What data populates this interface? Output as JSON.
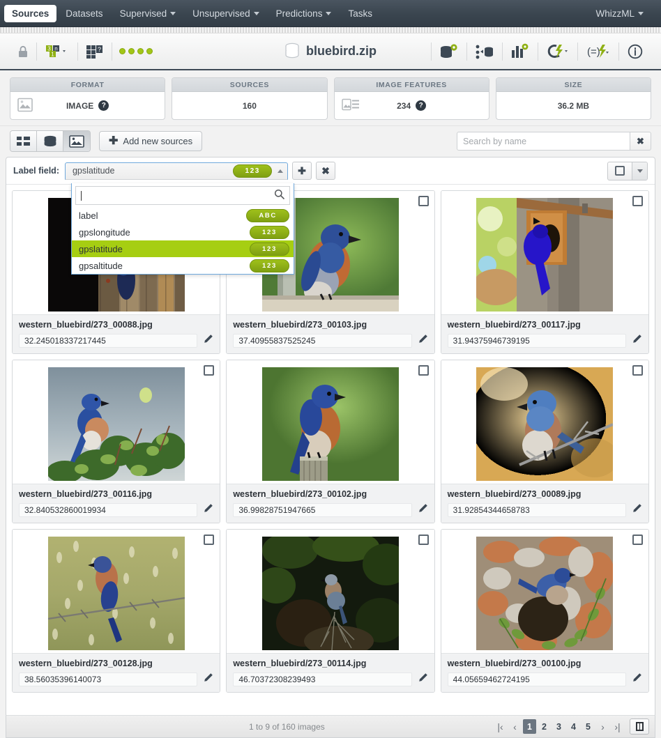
{
  "topnav": {
    "items": [
      {
        "label": "Sources",
        "active": true,
        "caret": false
      },
      {
        "label": "Datasets",
        "active": false,
        "caret": false
      },
      {
        "label": "Supervised",
        "active": false,
        "caret": true
      },
      {
        "label": "Unsupervised",
        "active": false,
        "caret": true
      },
      {
        "label": "Predictions",
        "active": false,
        "caret": true
      },
      {
        "label": "Tasks",
        "active": false,
        "caret": false
      }
    ],
    "right": {
      "label": "WhizzML",
      "caret": true
    }
  },
  "resource": {
    "title": "bluebird.zip",
    "left_icons": [
      "lock-icon",
      "field-types-icon",
      "dataset-transform-icon"
    ],
    "status_dots": 4,
    "right_icons": [
      "create-dataset-icon",
      "batch-source-icon",
      "statistics-icon",
      "flash-cluster-icon",
      "script-flash-icon",
      "info-icon"
    ]
  },
  "summary": [
    {
      "header": "FORMAT",
      "value": "IMAGE",
      "icon": "image-icon",
      "help": "?"
    },
    {
      "header": "SOURCES",
      "value": "160",
      "icon": null,
      "help": null
    },
    {
      "header": "IMAGE FEATURES",
      "value": "234",
      "icon": "image-list-icon",
      "help": "?"
    },
    {
      "header": "SIZE",
      "value": "36.2 MB",
      "icon": null,
      "help": null
    }
  ],
  "actionbar": {
    "views": [
      {
        "name": "list-view",
        "icon": "list-icon",
        "active": false
      },
      {
        "name": "composite-view",
        "icon": "stack-icon",
        "active": false
      },
      {
        "name": "image-view",
        "icon": "image-icon",
        "active": true
      }
    ],
    "add_sources_label": "Add new sources",
    "search_placeholder": "Search by name",
    "clear_label": "✖"
  },
  "label_field": {
    "caption": "Label field:",
    "selected": "gpslatitude",
    "selected_type": "123",
    "add_label": "✚",
    "remove_label": "✖",
    "search_value": "",
    "options": [
      {
        "name": "label",
        "type": "ABC",
        "selected": false
      },
      {
        "name": "gpslongitude",
        "type": "123",
        "selected": false
      },
      {
        "name": "gpslatitude",
        "type": "123",
        "selected": true
      },
      {
        "name": "gpsaltitude",
        "type": "123",
        "selected": false
      }
    ]
  },
  "images": [
    {
      "filename": "western_bluebird/273_00088.jpg",
      "value": "32.245018337217445",
      "thumb": "dark-wood-fence"
    },
    {
      "filename": "western_bluebird/273_00103.jpg",
      "value": "37.40955837525245",
      "thumb": "bluebird-on-post-green"
    },
    {
      "filename": "western_bluebird/273_00117.jpg",
      "value": "31.94375946739195",
      "thumb": "bluebird-at-nestbox"
    },
    {
      "filename": "western_bluebird/273_00116.jpg",
      "value": "32.840532860019934",
      "thumb": "bluebird-on-shrub-sky"
    },
    {
      "filename": "western_bluebird/273_00102.jpg",
      "value": "36.99828751947665",
      "thumb": "bluebird-on-stump-green"
    },
    {
      "filename": "western_bluebird/273_00089.jpg",
      "value": "31.92854344658783",
      "thumb": "bluebird-on-branch-gold"
    },
    {
      "filename": "western_bluebird/273_00128.jpg",
      "value": "38.56035396140073",
      "thumb": "bluebird-on-barbed-wire"
    },
    {
      "filename": "western_bluebird/273_00114.jpg",
      "value": "46.70372308239493",
      "thumb": "bluebird-dark-foliage"
    },
    {
      "filename": "western_bluebird/273_00100.jpg",
      "value": "44.05659462724195",
      "thumb": "bluebird-on-bark"
    }
  ],
  "footer": {
    "count_text": "1 to 9 of 160 images",
    "pages": [
      "1",
      "2",
      "3",
      "4",
      "5"
    ],
    "current_page": "1",
    "first_label": "|‹",
    "prev_label": "‹",
    "next_label": "›",
    "last_label": "›|"
  },
  "colors": {
    "accent_green": "#a6ce12",
    "nav_dark": "#3b4650",
    "pill_green": "#8fb015"
  }
}
